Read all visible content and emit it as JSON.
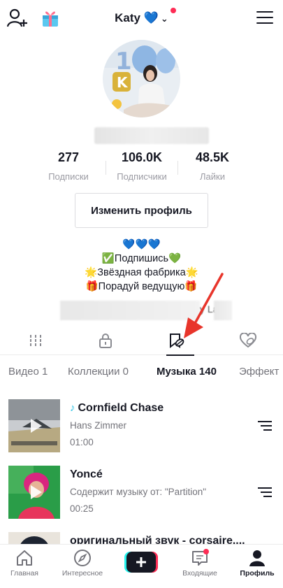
{
  "header": {
    "username": "Katy",
    "username_emoji": "💙",
    "colors": {
      "notification_dot": "#fe2c55"
    }
  },
  "stats": [
    {
      "value": "277",
      "label": "Подписки"
    },
    {
      "value": "106.0K",
      "label": "Подписчики"
    },
    {
      "value": "48.5K",
      "label": "Лайки"
    }
  ],
  "profile": {
    "edit_button": "Изменить профиль",
    "bio_lines": [
      "💙💙💙",
      "✅Подпишись💚",
      "🌟Звёздная фабрика🌟",
      "🎁Порадуй ведущую🎁"
    ],
    "link_suffix": "y  La"
  },
  "icon_tabs": [
    "videos-grid-icon",
    "private-lock-icon",
    "bookmark-icon",
    "liked-heart-icon"
  ],
  "sub_tabs": [
    {
      "label": "Видео 1"
    },
    {
      "label": "Коллекции 0"
    },
    {
      "label": "Музыка 140"
    },
    {
      "label": "Эффект"
    }
  ],
  "music": [
    {
      "title": "Cornfield Chase",
      "artist": "Hans Zimmer",
      "duration": "01:00",
      "badge_icon": "tiktok-note-icon"
    },
    {
      "title": "Yoncé",
      "artist": "Содержит музыку от: \"Partition\"",
      "duration": "00:25"
    },
    {
      "title": "оригинальный звук - corsaire...."
    }
  ],
  "bottom_nav": [
    {
      "label": "Главная",
      "icon": "home-icon"
    },
    {
      "label": "Интересное",
      "icon": "compass-icon"
    },
    {
      "label": "",
      "icon": "create-plus-icon"
    },
    {
      "label": "Входящие",
      "icon": "inbox-icon"
    },
    {
      "label": "Профиль",
      "icon": "profile-icon"
    }
  ]
}
